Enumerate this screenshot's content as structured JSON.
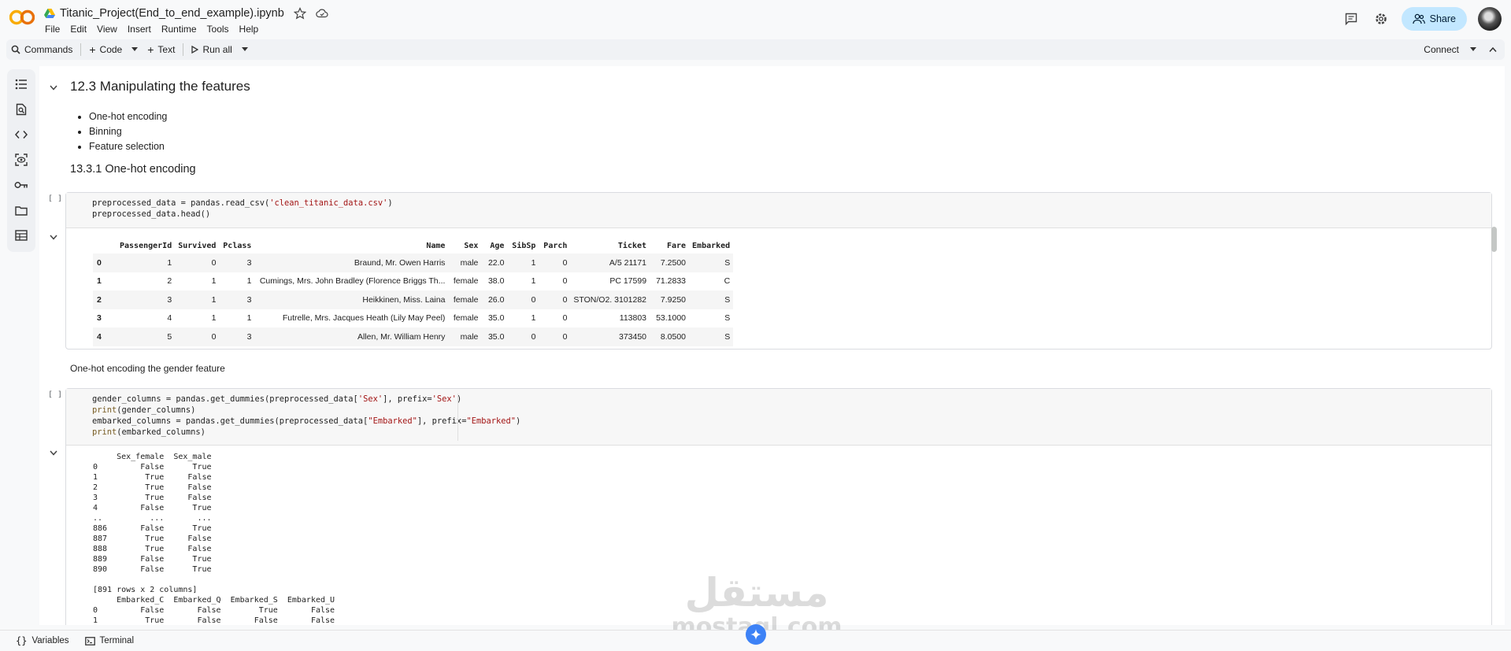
{
  "header": {
    "notebook_title": "Titanic_Project(End_to_end_example).ipynb",
    "menu": [
      "File",
      "Edit",
      "View",
      "Insert",
      "Runtime",
      "Tools",
      "Help"
    ],
    "share_label": "Share"
  },
  "toolbar": {
    "commands_label": "Commands",
    "code_label": "Code",
    "text_label": "Text",
    "run_all_label": "Run all",
    "connect_label": "Connect"
  },
  "sidebar": {
    "icons": [
      "toc-icon",
      "find-icon",
      "code-snippets-icon",
      "variables-inspector-icon",
      "secrets-key-icon",
      "files-icon",
      "data-table-icon"
    ]
  },
  "notebook": {
    "section_title": "12.3 Manipulating the features",
    "bullets": [
      "One-hot encoding",
      "Binning",
      "Feature selection"
    ],
    "subsection_title": "13.3.1 One-hot encoding",
    "cell1": {
      "bracket": "[ ]",
      "code": [
        [
          {
            "t": "preprocessed_data = pandas.read_csv(",
            "c": ""
          },
          {
            "t": "'clean_titanic_data.csv'",
            "c": "str"
          },
          {
            "t": ")",
            "c": ""
          }
        ],
        [
          {
            "t": "preprocessed_data.head()",
            "c": ""
          }
        ]
      ],
      "dataframe": {
        "columns": [
          "",
          "PassengerId",
          "Survived",
          "Pclass",
          "Name",
          "Sex",
          "Age",
          "SibSp",
          "Parch",
          "Ticket",
          "Fare",
          "Embarked"
        ],
        "rows": [
          [
            "0",
            "1",
            "0",
            "3",
            "Braund, Mr. Owen Harris",
            "male",
            "22.0",
            "1",
            "0",
            "A/5 21171",
            "7.2500",
            "S"
          ],
          [
            "1",
            "2",
            "1",
            "1",
            "Cumings, Mrs. John Bradley (Florence Briggs Th...",
            "female",
            "38.0",
            "1",
            "0",
            "PC 17599",
            "71.2833",
            "C"
          ],
          [
            "2",
            "3",
            "1",
            "3",
            "Heikkinen, Miss. Laina",
            "female",
            "26.0",
            "0",
            "0",
            "STON/O2. 3101282",
            "7.9250",
            "S"
          ],
          [
            "3",
            "4",
            "1",
            "1",
            "Futrelle, Mrs. Jacques Heath (Lily May Peel)",
            "female",
            "35.0",
            "1",
            "0",
            "113803",
            "53.1000",
            "S"
          ],
          [
            "4",
            "5",
            "0",
            "3",
            "Allen, Mr. William Henry",
            "male",
            "35.0",
            "0",
            "0",
            "373450",
            "8.0500",
            "S"
          ]
        ]
      }
    },
    "text_cell": "One-hot encoding the gender feature",
    "cell2": {
      "bracket": "[ ]",
      "code": [
        [
          {
            "t": "gender_columns = pandas.get_dummies(preprocessed_data[",
            "c": ""
          },
          {
            "t": "'Sex'",
            "c": "str"
          },
          {
            "t": "], prefix=",
            "c": ""
          },
          {
            "t": "'Sex'",
            "c": "str"
          },
          {
            "t": ")",
            "c": ""
          }
        ],
        [
          {
            "t": "print",
            "c": "fn"
          },
          {
            "t": "(gender_columns)",
            "c": ""
          }
        ],
        [
          {
            "t": "embarked_columns = pandas.get_dummies(preprocessed_data[",
            "c": ""
          },
          {
            "t": "\"Embarked\"",
            "c": "str"
          },
          {
            "t": "], prefix=",
            "c": ""
          },
          {
            "t": "\"Embarked\"",
            "c": "str"
          },
          {
            "t": ")",
            "c": ""
          }
        ],
        [
          {
            "t": "print",
            "c": "fn"
          },
          {
            "t": "(embarked_columns)",
            "c": ""
          }
        ]
      ],
      "output_lines": [
        "     Sex_female  Sex_male",
        "0         False      True",
        "1          True     False",
        "2          True     False",
        "3          True     False",
        "4         False      True",
        "..          ...       ...",
        "886       False      True",
        "887        True     False",
        "888        True     False",
        "889       False      True",
        "890       False      True",
        "",
        "[891 rows x 2 columns]",
        "     Embarked_C  Embarked_Q  Embarked_S  Embarked_U",
        "0         False       False        True       False",
        "1          True       False       False       False"
      ]
    }
  },
  "bottombar": {
    "variables_label": "Variables",
    "terminal_label": "Terminal"
  },
  "watermark": {
    "line1": "مستقل",
    "line2": "mostaql.com"
  }
}
